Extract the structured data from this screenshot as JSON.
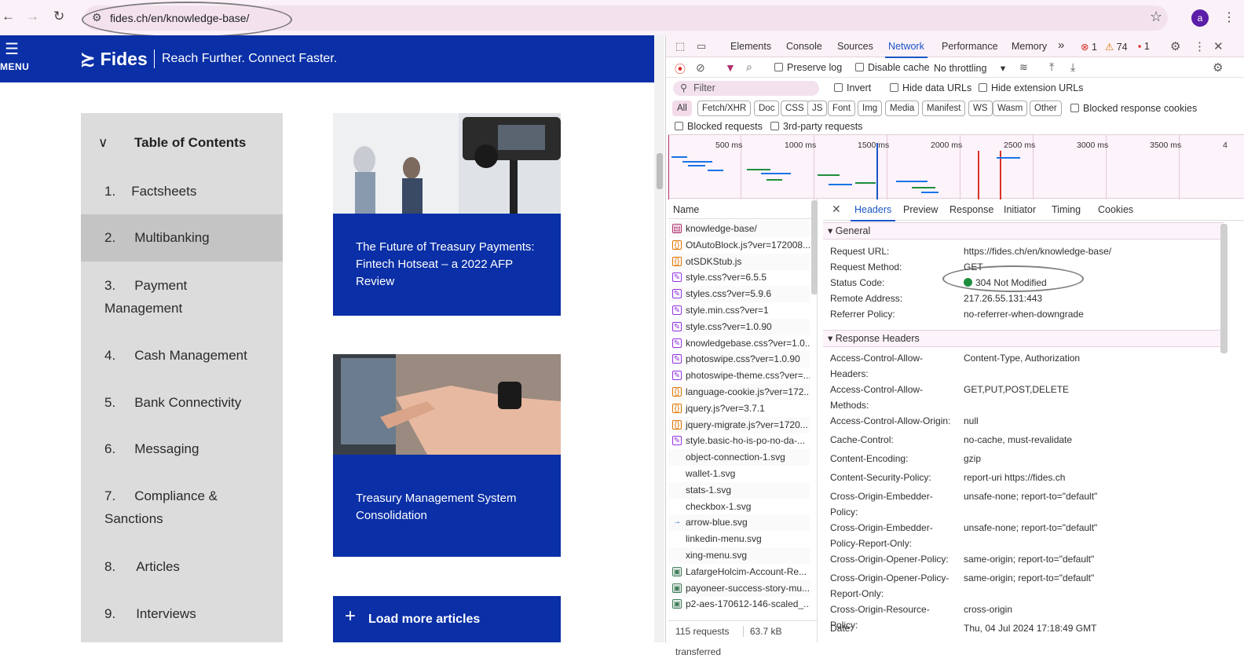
{
  "browser": {
    "url": "fides.ch/en/knowledge-base/",
    "avatar_letter": "a"
  },
  "site": {
    "menu_label": "MENU",
    "logo_text": "Fides",
    "tagline": "Reach Further. Connect Faster.",
    "toc": {
      "heading": "Table of Contents",
      "items": [
        {
          "num": "1.",
          "label": "Factsheets"
        },
        {
          "num": "2.",
          "label": "Multibanking"
        },
        {
          "num": "3.",
          "label": "Payment",
          "label2": "Management"
        },
        {
          "num": "4.",
          "label": "Cash Management"
        },
        {
          "num": "5.",
          "label": "Bank Connectivity"
        },
        {
          "num": "6.",
          "label": "Messaging"
        },
        {
          "num": "7.",
          "label": "Compliance &",
          "label2": "Sanctions"
        },
        {
          "num": "8.",
          "label": "Articles"
        },
        {
          "num": "9.",
          "label": "Interviews"
        }
      ]
    },
    "cards": [
      {
        "title": "The Future of Treasury Payments: Fintech Hotseat – a 2022 AFP Review"
      },
      {
        "title": "Treasury Management System Consolidation"
      }
    ],
    "load_more": "Load more articles"
  },
  "devtools": {
    "tabs": [
      "Elements",
      "Console",
      "Sources",
      "Network",
      "Performance",
      "Memory"
    ],
    "selected_tab": "Network",
    "more_tabs": "»",
    "errors": "1",
    "warnings": "74",
    "issues": "1",
    "toolbar": {
      "preserve_log": "Preserve log",
      "disable_cache": "Disable cache",
      "throttling": "No throttling"
    },
    "filter": {
      "placeholder": "Filter",
      "invert": "Invert",
      "hide_data_urls": "Hide data URLs",
      "hide_extension_urls": "Hide extension URLs",
      "types": [
        "All",
        "Fetch/XHR",
        "Doc",
        "CSS",
        "JS",
        "Font",
        "Img",
        "Media",
        "Manifest",
        "WS",
        "Wasm",
        "Other"
      ],
      "blocked_response_cookies": "Blocked response cookies",
      "blocked_requests": "Blocked requests",
      "third_party": "3rd-party requests"
    },
    "overview_ticks": [
      "500 ms",
      "1000 ms",
      "1500 ms",
      "2000 ms",
      "2500 ms",
      "3000 ms",
      "3500 ms",
      "4"
    ],
    "name_header": "Name",
    "requests": [
      {
        "name": "knowledge-base/",
        "type": "doc"
      },
      {
        "name": "OtAutoBlock.js?ver=172008...",
        "type": "js"
      },
      {
        "name": "otSDKStub.js",
        "type": "js"
      },
      {
        "name": "style.css?ver=6.5.5",
        "type": "css"
      },
      {
        "name": "styles.css?ver=5.9.6",
        "type": "css"
      },
      {
        "name": "style.min.css?ver=1",
        "type": "css"
      },
      {
        "name": "style.css?ver=1.0.90",
        "type": "css"
      },
      {
        "name": "knowledgebase.css?ver=1.0....",
        "type": "css"
      },
      {
        "name": "photoswipe.css?ver=1.0.90",
        "type": "css"
      },
      {
        "name": "photoswipe-theme.css?ver=...",
        "type": "css"
      },
      {
        "name": "language-cookie.js?ver=172...",
        "type": "js"
      },
      {
        "name": "jquery.js?ver=3.7.1",
        "type": "js"
      },
      {
        "name": "jquery-migrate.js?ver=1720...",
        "type": "js"
      },
      {
        "name": "style.basic-ho-is-po-no-da-...",
        "type": "css"
      },
      {
        "name": "object-connection-1.svg",
        "type": "svg"
      },
      {
        "name": "wallet-1.svg",
        "type": "svg"
      },
      {
        "name": "stats-1.svg",
        "type": "svg"
      },
      {
        "name": "checkbox-1.svg",
        "type": "svg"
      },
      {
        "name": "arrow-blue.svg",
        "type": "arrow"
      },
      {
        "name": "linkedin-menu.svg",
        "type": "svg"
      },
      {
        "name": "xing-menu.svg",
        "type": "svg"
      },
      {
        "name": "LafargeHolcim-Account-Re...",
        "type": "img"
      },
      {
        "name": "payoneer-success-story-mu...",
        "type": "img"
      },
      {
        "name": "p2-aes-170612-146-scaled_...",
        "type": "img"
      }
    ],
    "footer": {
      "requests": "115 requests",
      "transferred": "63.7 kB transferred"
    },
    "detail_tabs": [
      "Headers",
      "Preview",
      "Response",
      "Initiator",
      "Timing",
      "Cookies"
    ],
    "selected_detail_tab": "Headers",
    "general_heading": "General",
    "general": [
      {
        "k": "Request URL:",
        "v": "https://fides.ch/en/knowledge-base/"
      },
      {
        "k": "Request Method:",
        "v": "GET"
      },
      {
        "k": "Status Code:",
        "v": "304 Not Modified"
      },
      {
        "k": "Remote Address:",
        "v": "217.26.55.131:443"
      },
      {
        "k": "Referrer Policy:",
        "v": "no-referrer-when-downgrade"
      }
    ],
    "response_heading": "Response Headers",
    "response_headers": [
      {
        "k": "Access-Control-Allow-",
        "k2": "Headers:",
        "v": "Content-Type, Authorization"
      },
      {
        "k": "Access-Control-Allow-",
        "k2": "Methods:",
        "v": "GET,PUT,POST,DELETE"
      },
      {
        "k": "Access-Control-Allow-Origin:",
        "v": "null"
      },
      {
        "k": "Cache-Control:",
        "v": "no-cache, must-revalidate"
      },
      {
        "k": "Content-Encoding:",
        "v": "gzip"
      },
      {
        "k": "Content-Security-Policy:",
        "v": "report-uri https://fides.ch"
      },
      {
        "k": "Cross-Origin-Embedder-",
        "k2": "Policy:",
        "v": "unsafe-none; report-to=\"default\""
      },
      {
        "k": "Cross-Origin-Embedder-",
        "k2": "Policy-Report-Only:",
        "v": "unsafe-none; report-to=\"default\""
      },
      {
        "k": "Cross-Origin-Opener-Policy:",
        "v": "same-origin; report-to=\"default\""
      },
      {
        "k": "Cross-Origin-Opener-Policy-",
        "k2": "Report-Only:",
        "v": "same-origin; report-to=\"default\""
      },
      {
        "k": "Cross-Origin-Resource-Policy:",
        "v": "cross-origin"
      },
      {
        "k": "Date:",
        "v": "Thu, 04 Jul 2024 17:18:49 GMT"
      }
    ],
    "colors": {
      "accent": "#1a55c6",
      "status_ok": "#1e8e3e",
      "error": "#d93025",
      "warning": "#e37400"
    }
  }
}
